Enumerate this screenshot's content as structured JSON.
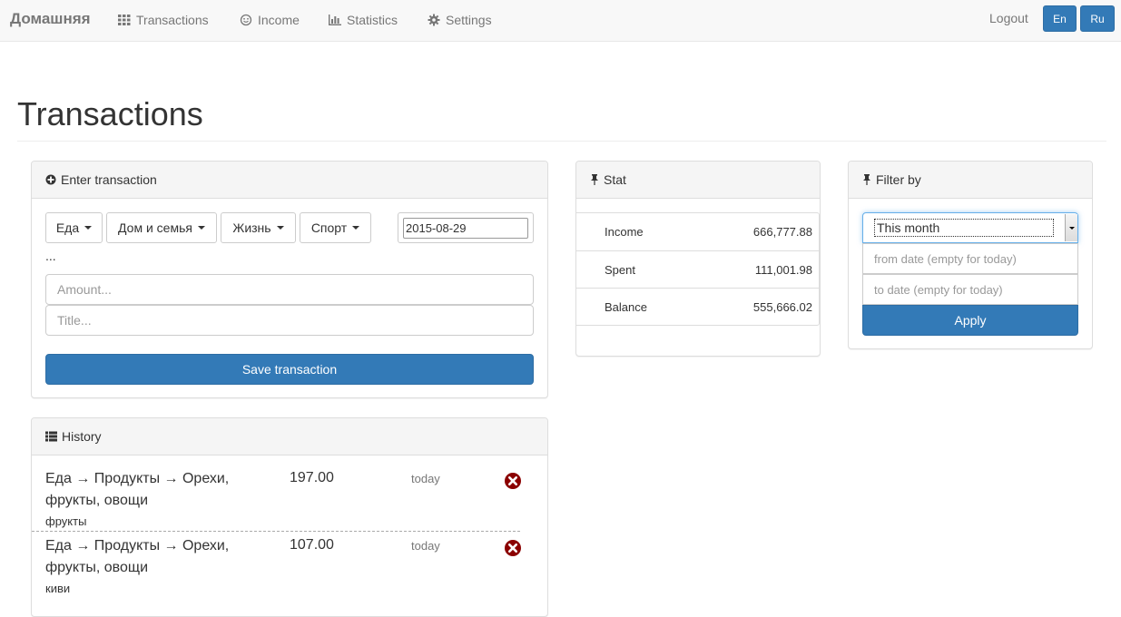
{
  "navbar": {
    "brand": "Домашняя",
    "items": [
      {
        "label": "Transactions",
        "icon": "grid-icon"
      },
      {
        "label": "Income",
        "icon": "smile-icon"
      },
      {
        "label": "Statistics",
        "icon": "bar-chart-icon"
      },
      {
        "label": "Settings",
        "icon": "gear-icon"
      }
    ],
    "logout": "Logout",
    "lang_en": "En",
    "lang_ru": "Ru",
    "accent_color": "#337ab7"
  },
  "page": {
    "title": "Transactions"
  },
  "enter": {
    "heading": "Enter transaction",
    "categories": [
      "Еда",
      "Дом и семья",
      "Жизнь",
      "Спорт"
    ],
    "date_value": "2015-08-29",
    "ellipsis": "...",
    "amount_placeholder": "Amount...",
    "title_placeholder": "Title...",
    "save_label": "Save transaction"
  },
  "stat": {
    "heading": "Stat",
    "rows": [
      {
        "label": "Income",
        "value": "666,777.88"
      },
      {
        "label": "Spent",
        "value": "111,001.98"
      },
      {
        "label": "Balance",
        "value": "555,666.02"
      }
    ]
  },
  "filter": {
    "heading": "Filter by",
    "period_selected": "This month",
    "from_placeholder": "from date (empty for today)",
    "to_placeholder": "to date (empty for today)",
    "apply_label": "Apply"
  },
  "history": {
    "heading": "History",
    "items": [
      {
        "title": "Еда → Продукты → Орехи, фрукты, овощи",
        "amount": "197.00",
        "when": "today",
        "note": "фрукты"
      },
      {
        "title": "Еда → Продукты → Орехи, фрукты, овощи",
        "amount": "107.00",
        "when": "today",
        "note": "киви"
      }
    ]
  }
}
